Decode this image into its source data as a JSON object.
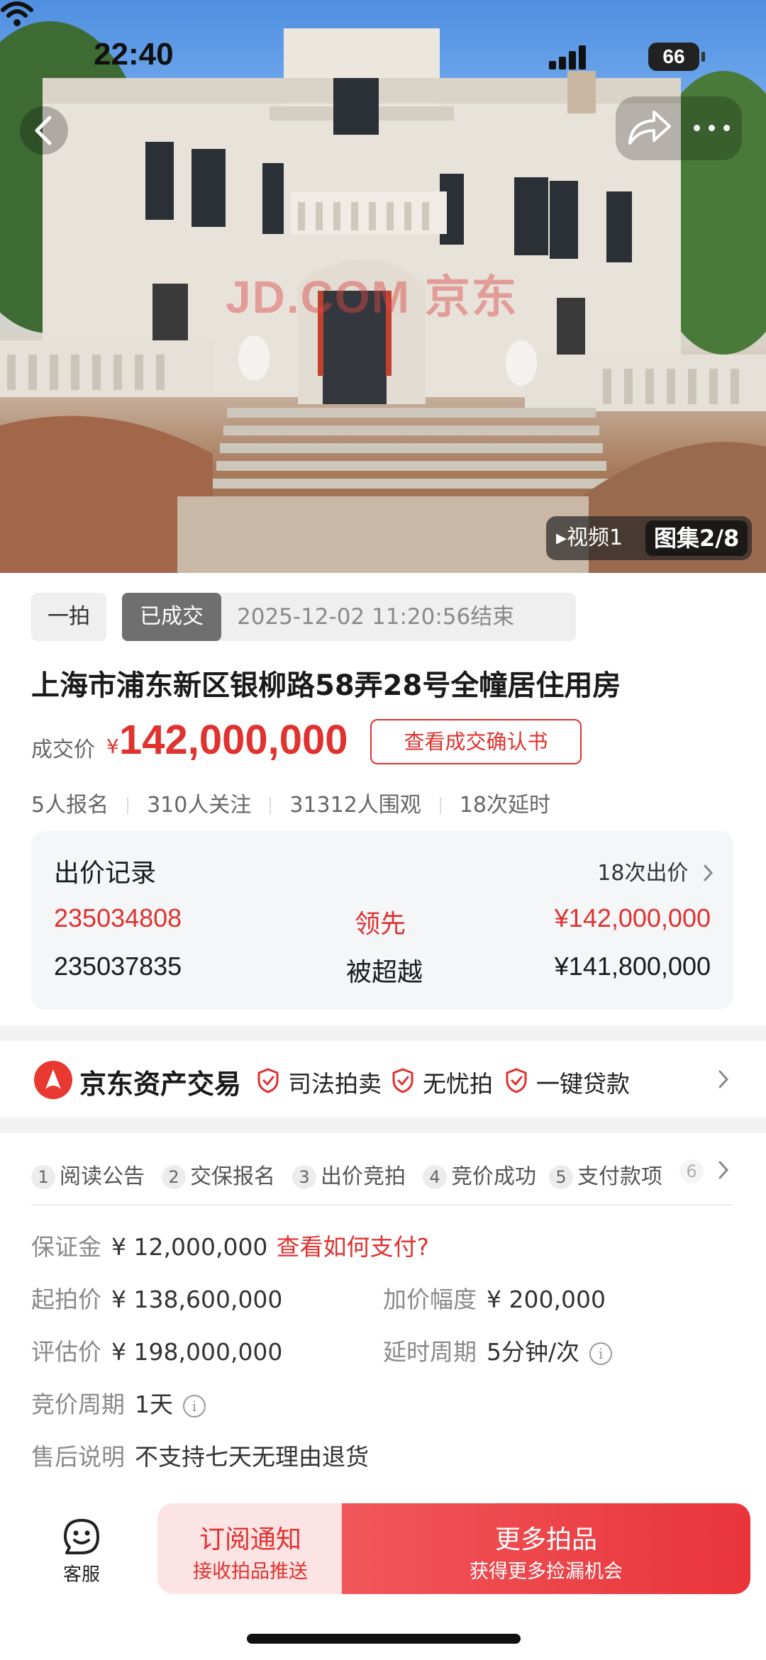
{
  "status_bar": {
    "time": "22:40",
    "battery": "66"
  },
  "hero": {
    "watermark": "JD.COM 京东",
    "video_label": "▸视频1",
    "gallery_label": "图集2/8"
  },
  "tags": {
    "auction_round": "一拍",
    "status": "已成交",
    "end_time": "2025-12-02 11:20:56结束"
  },
  "title": "上海市浦东新区银柳路58弄28号全幢居住用房",
  "deal": {
    "label": "成交价",
    "currency": "¥",
    "price": "142,000,000",
    "confirm_button": "查看成交确认书"
  },
  "stats": [
    "5人报名",
    "310人关注",
    "31312人围观",
    "18次延时"
  ],
  "bid_record": {
    "title": "出价记录",
    "count_link": "18次出价",
    "rows": [
      {
        "bidder": "235034808",
        "status": "领先",
        "amount": "¥142,000,000"
      },
      {
        "bidder": "235037835",
        "status": "被超越",
        "amount": "¥141,800,000"
      }
    ]
  },
  "brand": {
    "name": "京东资产交易",
    "features": [
      "司法拍卖",
      "无忧拍",
      "一键贷款"
    ]
  },
  "steps": [
    {
      "num": "1",
      "label": "阅读公告"
    },
    {
      "num": "2",
      "label": "交保报名"
    },
    {
      "num": "3",
      "label": "出价竞拍"
    },
    {
      "num": "4",
      "label": "竞价成功"
    },
    {
      "num": "5",
      "label": "支付款项"
    },
    {
      "num": "6",
      "label": ""
    }
  ],
  "details": {
    "deposit_label": "保证金",
    "deposit_value": "¥ 12,000,000",
    "deposit_link": "查看如何支付?",
    "start_label": "起拍价",
    "start_value": "¥ 138,600,000",
    "increment_label": "加价幅度",
    "increment_value": "¥ 200,000",
    "appraisal_label": "评估价",
    "appraisal_value": "¥ 198,000,000",
    "delay_label": "延时周期",
    "delay_value": "5分钟/次",
    "cycle_label": "竞价周期",
    "cycle_value": "1天",
    "aftersale_label": "售后说明",
    "aftersale_value": "不支持七天无理由退货"
  },
  "bottom_bar": {
    "service_label": "客服",
    "subscribe_title": "订阅通知",
    "subscribe_sub": "接收拍品推送",
    "more_title": "更多拍品",
    "more_sub": "获得更多捡漏机会"
  },
  "colors": {
    "accent": "#e0322f",
    "bid_card_bg": "#f5f6f8"
  }
}
